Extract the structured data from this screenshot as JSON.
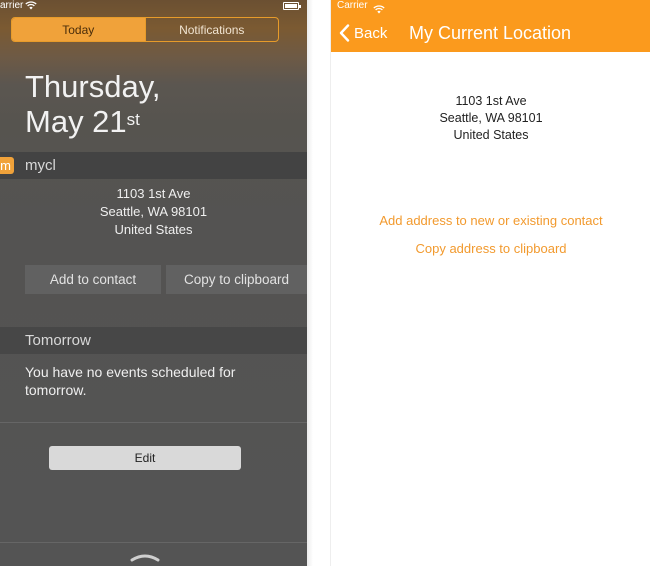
{
  "left_panel": {
    "status": {
      "carrier": "arrier"
    },
    "segmented": {
      "today": "Today",
      "notifications": "Notifications",
      "selected": "Today"
    },
    "date": {
      "weekday": "Thursday,",
      "month_day": "May 21",
      "suffix": "st"
    },
    "widget": {
      "badge": "m",
      "title": "mycl",
      "address": [
        "1103 1st Ave",
        "Seattle, WA 98101",
        "United States"
      ],
      "add_button": "Add to contact",
      "copy_button": "Copy to clipboard"
    },
    "tomorrow": {
      "title": "Tomorrow",
      "message": "You have no events scheduled for tomorrow."
    },
    "edit_button": "Edit"
  },
  "right_panel": {
    "status": {
      "carrier": "Carrier"
    },
    "nav": {
      "back_label": "Back",
      "title": "My Current Location"
    },
    "address": [
      "1103 1st Ave",
      "Seattle, WA 98101",
      "United States"
    ],
    "links": {
      "add": "Add address to new or existing contact",
      "copy": "Copy address to clipboard"
    }
  },
  "colors": {
    "accent": "#fb9a1d",
    "link": "#f29a2e",
    "widget_header": "#434343",
    "panel_bg": "#545454"
  },
  "icons": {
    "wifi": "wifi-icon",
    "battery": "battery-icon",
    "back": "chevron-left-icon",
    "grabber": "chevron-up-icon"
  }
}
